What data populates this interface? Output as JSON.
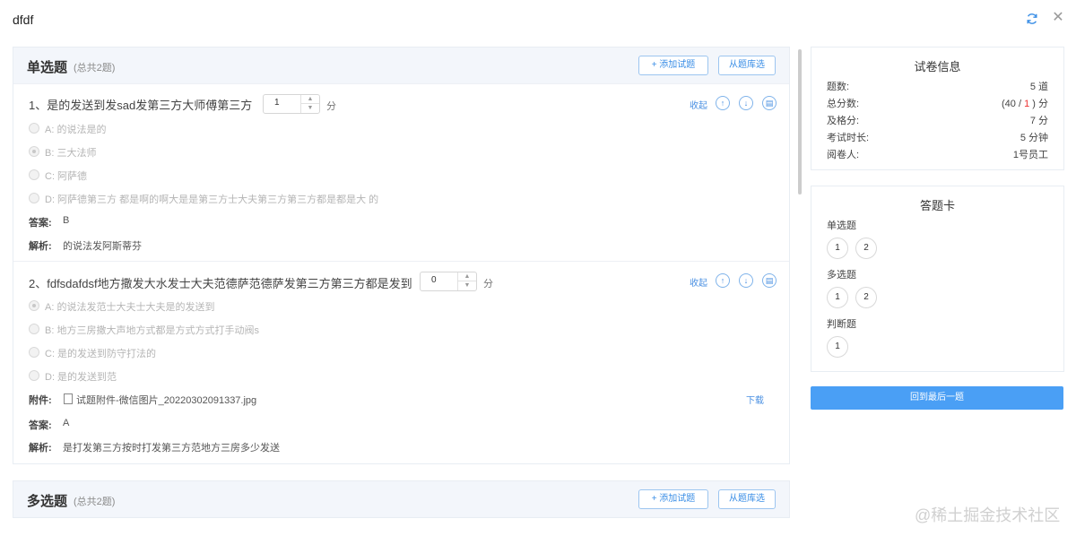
{
  "header": {
    "title": "dfdf"
  },
  "sections": [
    {
      "title": "单选题",
      "count": "(总共2题)",
      "add_label": "+ 添加试题",
      "lib_label": "从题库选"
    },
    {
      "title": "多选题",
      "count": "(总共2题)",
      "add_label": "+ 添加试题",
      "lib_label": "从题库选"
    }
  ],
  "questions": [
    {
      "title": "1、是的发送到发sad发第三方大师傅第三方",
      "score": "1",
      "unit": "分",
      "collapse": "收起",
      "options": [
        "A:  的说法是的",
        "B:  三大法师",
        "C:  阿萨德",
        "D:  阿萨德第三方 都是啊的啊大是是第三方士大夫第三方第三方都是都是大 的"
      ],
      "answer_label": "答案:",
      "answer": "B",
      "analysis_label": "解析:",
      "analysis": "的说法发阿斯蒂芬"
    },
    {
      "title": "2、fdfsdafdsf地方撒发大水发士大夫范德萨范德萨发第三方第三方都是发到",
      "score": "0",
      "unit": "分",
      "collapse": "收起",
      "options": [
        "A:  的说法发范士大夫士大夫是的发送到",
        "B:  地方三房撒大声地方式都是方式方式打手动阀s",
        "C:  是的发送到防守打法的",
        "D:  是的发送到范"
      ],
      "attach_label": "附件:",
      "attachment": "试题附件-微信图片_20220302091337.jpg",
      "download": "下载",
      "answer_label": "答案:",
      "answer": "A",
      "analysis_label": "解析:",
      "analysis": "是打发第三方按时打发第三方范地方三房多少发送"
    }
  ],
  "info": {
    "title": "试卷信息",
    "rows": [
      {
        "k": "题数:",
        "v": "5 道"
      },
      {
        "k": "总分数:",
        "v_pre": "(40 / ",
        "v_red": "1",
        "v_post": " ) 分"
      },
      {
        "k": "及格分:",
        "v": "7 分"
      },
      {
        "k": "考试时长:",
        "v": "5 分钟"
      },
      {
        "k": "阅卷人:",
        "v": "1号员工"
      }
    ]
  },
  "card": {
    "title": "答题卡",
    "groups": [
      {
        "label": "单选题",
        "nums": [
          "1",
          "2"
        ]
      },
      {
        "label": "多选题",
        "nums": [
          "1",
          "2"
        ]
      },
      {
        "label": "判断题",
        "nums": [
          "1"
        ]
      }
    ]
  },
  "back_button": "回到最后一题",
  "watermark": "@稀土掘金技术社区",
  "colors": {
    "accent": "#4a9ff5",
    "score_red": "#e33"
  }
}
